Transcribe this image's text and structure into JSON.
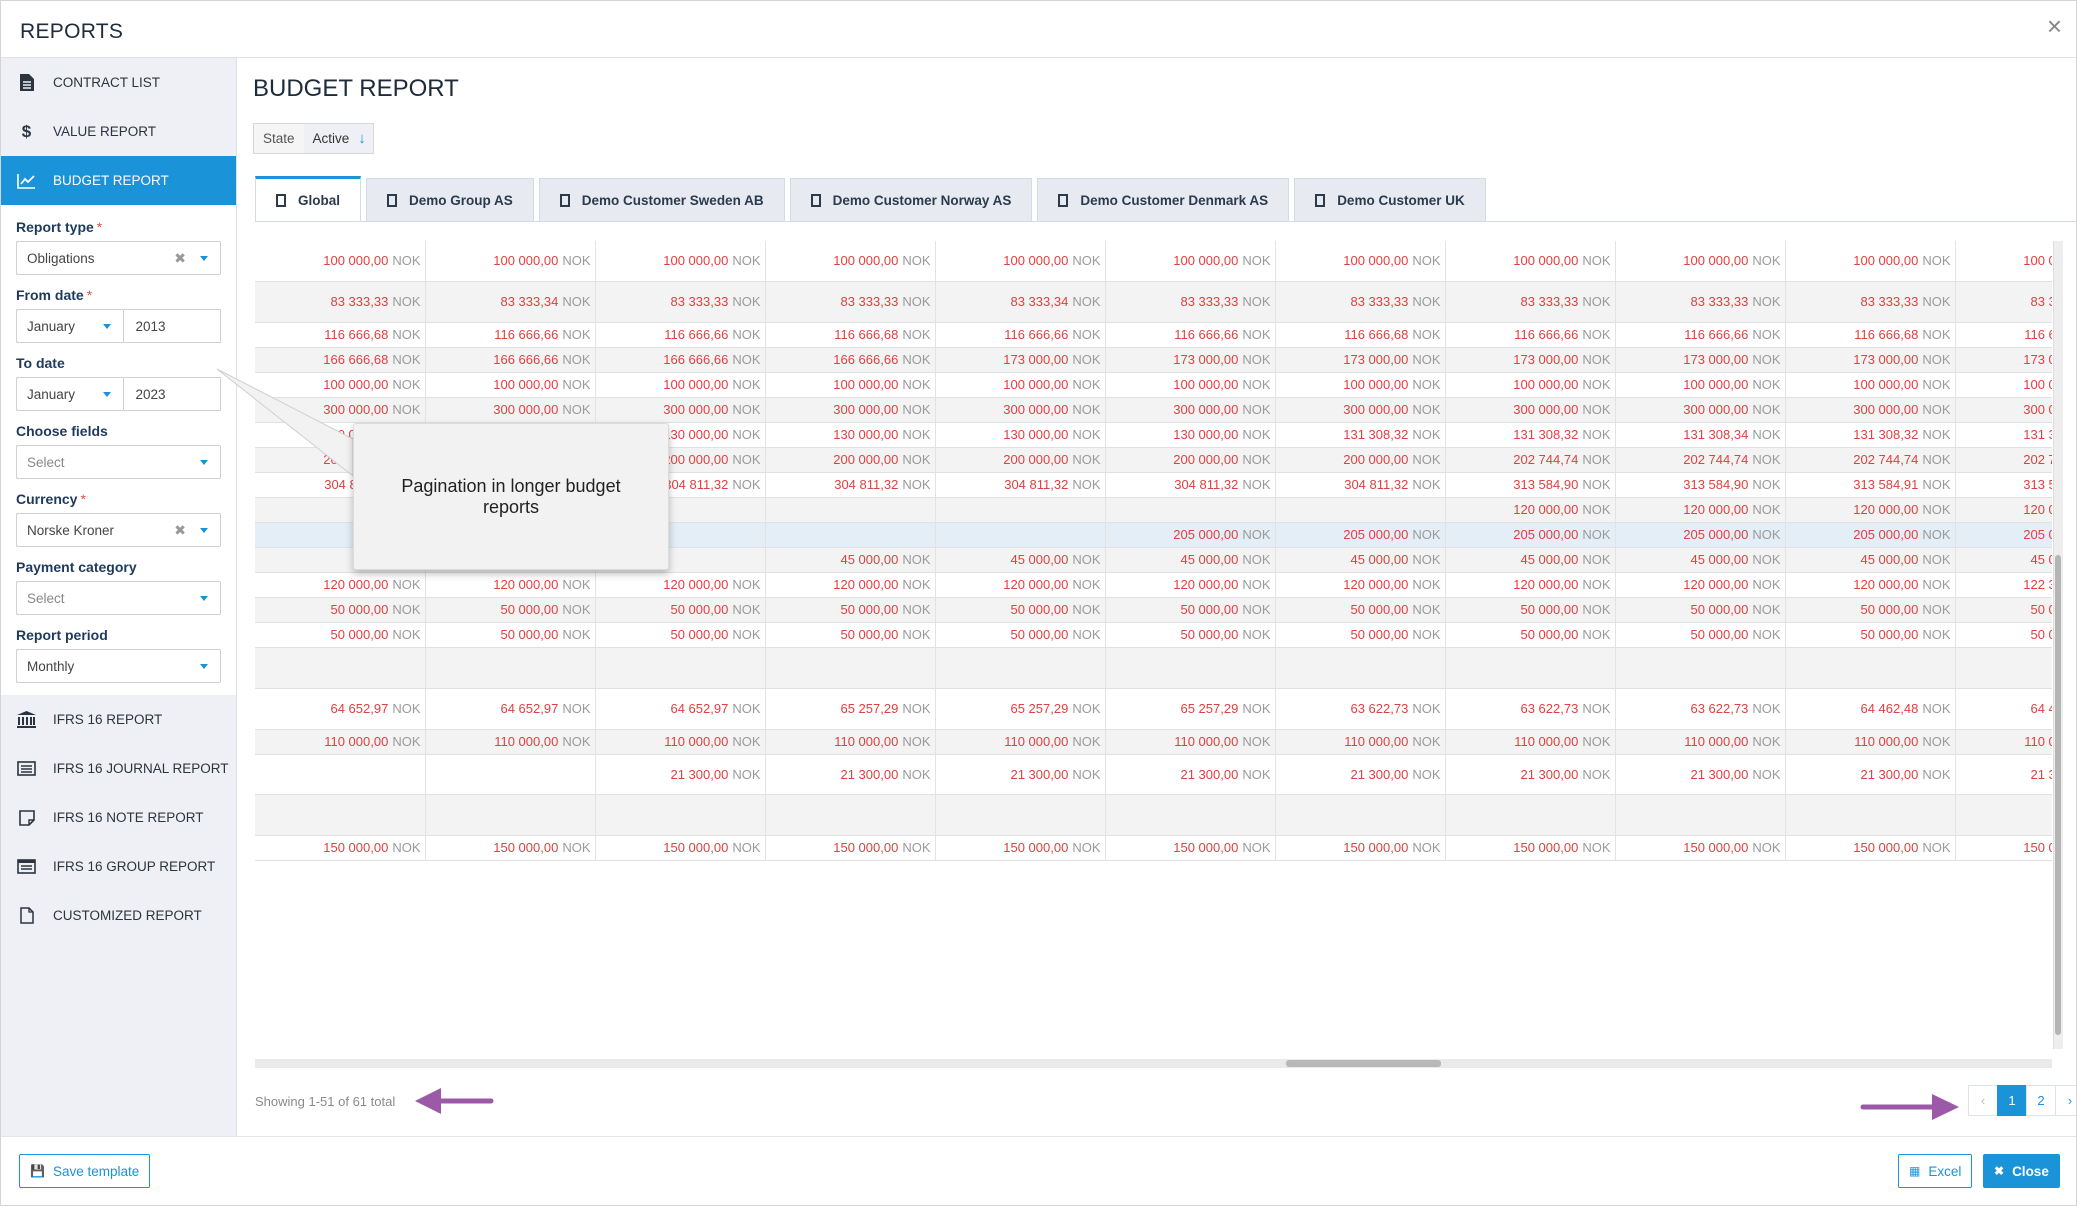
{
  "app": {
    "title": "REPORTS",
    "close_glyph": "×"
  },
  "sidebar": {
    "top_items": [
      {
        "label": "CONTRACT LIST",
        "icon": "file-icon"
      },
      {
        "label": "VALUE REPORT",
        "icon": "dollar-icon"
      },
      {
        "label": "BUDGET REPORT",
        "icon": "line-chart-icon",
        "active": true
      }
    ],
    "filters": {
      "report_type": {
        "label": "Report type",
        "required": "*",
        "value": "Obligations"
      },
      "from_date": {
        "label": "From date",
        "required": "*",
        "month": "January",
        "year": "2013"
      },
      "to_date": {
        "label": "To date",
        "month": "January",
        "year": "2023"
      },
      "choose_fields": {
        "label": "Choose fields",
        "placeholder": "Select"
      },
      "currency": {
        "label": "Currency",
        "required": "*",
        "value": "Norske Kroner"
      },
      "payment_category": {
        "label": "Payment category",
        "placeholder": "Select"
      },
      "report_period": {
        "label": "Report period",
        "value": "Monthly"
      }
    },
    "bottom_items": [
      {
        "label": "IFRS 16 REPORT",
        "icon": "bank-icon"
      },
      {
        "label": "IFRS 16 JOURNAL REPORT",
        "icon": "journal-icon"
      },
      {
        "label": "IFRS 16 NOTE REPORT",
        "icon": "note-icon"
      },
      {
        "label": "IFRS 16 GROUP REPORT",
        "icon": "group-report-icon"
      },
      {
        "label": "CUSTOMIZED REPORT",
        "icon": "document-icon"
      }
    ]
  },
  "main": {
    "title": "BUDGET REPORT",
    "state_filter": {
      "key": "State",
      "value": "Active",
      "arrow": "↓"
    },
    "tabs": [
      "Global",
      "Demo Group AS",
      "Demo Customer Sweden AB",
      "Demo Customer Norway AS",
      "Demo Customer Denmark AS",
      "Demo Customer UK"
    ],
    "currency_code": "NOK",
    "rows": [
      {
        "height": 40,
        "shade": false,
        "cells": [
          "100 000,00",
          "100 000,00",
          "100 000,00",
          "100 000,00",
          "100 000,00",
          "100 000,00",
          "100 000,00",
          "100 000,00",
          "100 000,00",
          "100 000,00",
          "100 000,00"
        ]
      },
      {
        "height": 41,
        "shade": true,
        "cells": [
          "83 333,33",
          "83 333,34",
          "83 333,33",
          "83 333,33",
          "83 333,34",
          "83 333,33",
          "83 333,33",
          "83 333,33",
          "83 333,33",
          "83 333,33",
          "83 333,34"
        ]
      },
      {
        "height": 25,
        "shade": false,
        "cells": [
          "116 666,68",
          "116 666,66",
          "116 666,66",
          "116 666,68",
          "116 666,66",
          "116 666,66",
          "116 666,68",
          "116 666,66",
          "116 666,66",
          "116 666,68",
          "116 666,66"
        ]
      },
      {
        "height": 25,
        "shade": true,
        "cells": [
          "166 666,68",
          "166 666,66",
          "166 666,66",
          "166 666,66",
          "173 000,00",
          "173 000,00",
          "173 000,00",
          "173 000,00",
          "173 000,00",
          "173 000,00",
          "173 000,00"
        ]
      },
      {
        "height": 25,
        "shade": false,
        "cells": [
          "100 000,00",
          "100 000,00",
          "100 000,00",
          "100 000,00",
          "100 000,00",
          "100 000,00",
          "100 000,00",
          "100 000,00",
          "100 000,00",
          "100 000,00",
          "100 000,00"
        ]
      },
      {
        "height": 25,
        "shade": true,
        "cells": [
          "300 000,00",
          "300 000,00",
          "300 000,00",
          "300 000,00",
          "300 000,00",
          "300 000,00",
          "300 000,00",
          "300 000,00",
          "300 000,00",
          "300 000,00",
          "300 000,00"
        ]
      },
      {
        "height": 25,
        "shade": false,
        "cells": [
          "130 000,00",
          "130 000,00",
          "130 000,00",
          "130 000,00",
          "130 000,00",
          "130 000,00",
          "131 308,32",
          "131 308,32",
          "131 308,34",
          "131 308,32",
          "131 308,32"
        ]
      },
      {
        "height": 25,
        "shade": true,
        "cells": [
          "200 000,00",
          "200 000,00",
          "200 000,00",
          "200 000,00",
          "200 000,00",
          "200 000,00",
          "200 000,00",
          "202 744,74",
          "202 744,74",
          "202 744,74",
          "202 744,74"
        ]
      },
      {
        "height": 25,
        "shade": false,
        "cells": [
          "304 811,32",
          "304 811,32",
          "304 811,32",
          "304 811,32",
          "304 811,32",
          "304 811,32",
          "304 811,32",
          "313 584,90",
          "313 584,90",
          "313 584,91",
          "313 584,90"
        ]
      },
      {
        "height": 25,
        "shade": true,
        "cells": [
          "",
          "",
          "",
          "",
          "",
          "",
          "",
          "120 000,00",
          "120 000,00",
          "120 000,00",
          "120 000,00"
        ]
      },
      {
        "height": 25,
        "blue": true,
        "cells": [
          "",
          "",
          "",
          "",
          "",
          "205 000,00",
          "205 000,00",
          "205 000,00",
          "205 000,00",
          "205 000,00",
          "205 000,00"
        ]
      },
      {
        "height": 25,
        "shade": true,
        "cells": [
          "",
          "",
          "",
          "45 000,00",
          "45 000,00",
          "45 000,00",
          "45 000,00",
          "45 000,00",
          "45 000,00",
          "45 000,00",
          "45 000,00"
        ]
      },
      {
        "height": 25,
        "shade": false,
        "cells": [
          "120 000,00",
          "120 000,00",
          "120 000,00",
          "120 000,00",
          "120 000,00",
          "120 000,00",
          "120 000,00",
          "120 000,00",
          "120 000,00",
          "120 000,00",
          "122 305,58"
        ]
      },
      {
        "height": 25,
        "shade": true,
        "cells": [
          "50 000,00",
          "50 000,00",
          "50 000,00",
          "50 000,00",
          "50 000,00",
          "50 000,00",
          "50 000,00",
          "50 000,00",
          "50 000,00",
          "50 000,00",
          "50 000,00"
        ]
      },
      {
        "height": 25,
        "shade": false,
        "cells": [
          "50 000,00",
          "50 000,00",
          "50 000,00",
          "50 000,00",
          "50 000,00",
          "50 000,00",
          "50 000,00",
          "50 000,00",
          "50 000,00",
          "50 000,00",
          "50 000,00"
        ]
      },
      {
        "height": 41,
        "shade": true,
        "cells": [
          "",
          "",
          "",
          "",
          "",
          "",
          "",
          "",
          "",
          "",
          ""
        ]
      },
      {
        "height": 41,
        "shade": false,
        "cells": [
          "64 652,97",
          "64 652,97",
          "64 652,97",
          "65 257,29",
          "65 257,29",
          "65 257,29",
          "63 622,73",
          "63 622,73",
          "63 622,73",
          "64 462,48",
          "64 462,48"
        ]
      },
      {
        "height": 25,
        "shade": true,
        "cells": [
          "110 000,00",
          "110 000,00",
          "110 000,00",
          "110 000,00",
          "110 000,00",
          "110 000,00",
          "110 000,00",
          "110 000,00",
          "110 000,00",
          "110 000,00",
          "110 000,00"
        ]
      },
      {
        "height": 40,
        "shade": false,
        "cells": [
          "",
          "",
          "21 300,00",
          "21 300,00",
          "21 300,00",
          "21 300,00",
          "21 300,00",
          "21 300,00",
          "21 300,00",
          "21 300,00",
          "21 300,00"
        ]
      },
      {
        "height": 41,
        "shade": true,
        "cells": [
          "",
          "",
          "",
          "",
          "",
          "",
          "",
          "",
          "",
          "",
          ""
        ]
      },
      {
        "height": 25,
        "shade": false,
        "cells": [
          "150 000,00",
          "150 000,00",
          "150 000,00",
          "150 000,00",
          "150 000,00",
          "150 000,00",
          "150 000,00",
          "150 000,00",
          "150 000,00",
          "150 000,00",
          "150 000,00"
        ]
      }
    ],
    "showing": "Showing 1-51 of 61 total",
    "pagination": {
      "pages": [
        "1",
        "2"
      ],
      "active": "1",
      "prev": "‹",
      "next": "›"
    }
  },
  "callout": {
    "text": "Pagination in longer budget reports"
  },
  "annotation_color": "#9b59a7",
  "footer": {
    "save_template": "Save template",
    "excel": "Excel",
    "close": "Close",
    "close_glyph": "✖"
  }
}
